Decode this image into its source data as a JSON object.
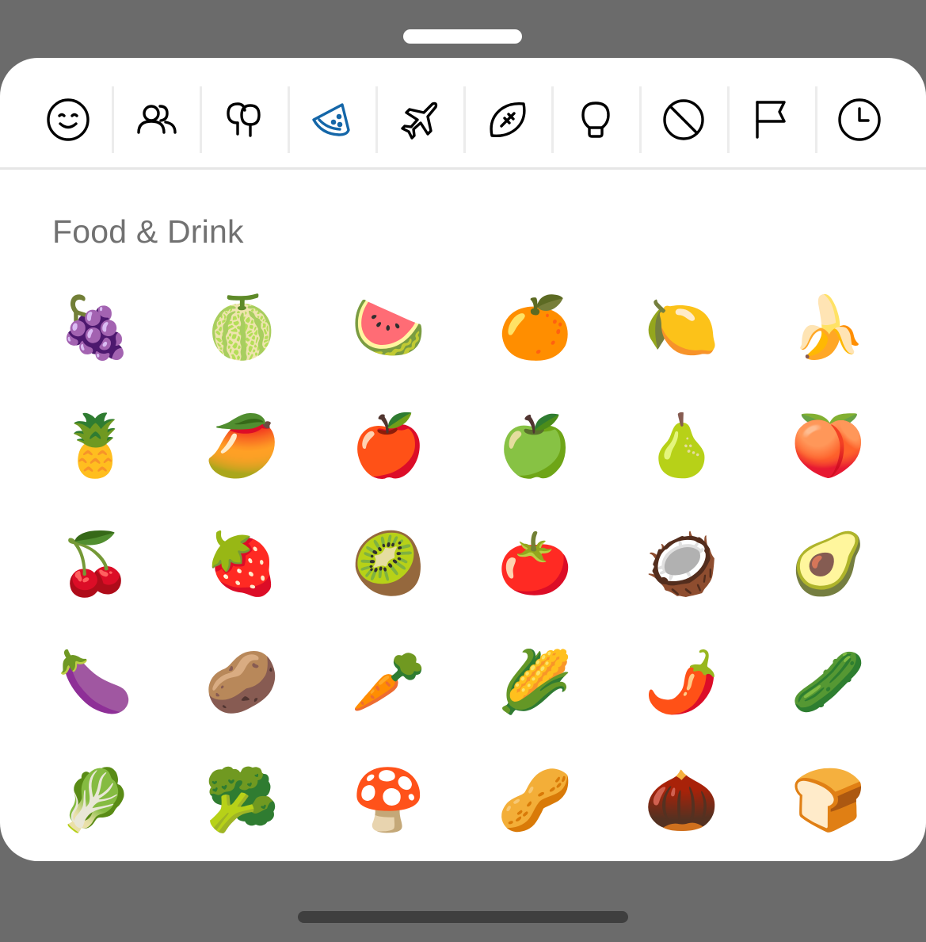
{
  "section_title": "Food & Drink",
  "accent_color": "#1466a8",
  "category_tabs": [
    {
      "icon": "smiley-face-icon",
      "active": false
    },
    {
      "icon": "people-icon",
      "active": false
    },
    {
      "icon": "trees-nature-icon",
      "active": false
    },
    {
      "icon": "watermelon-slice-food-icon",
      "active": true
    },
    {
      "icon": "airplane-travel-icon",
      "active": false
    },
    {
      "icon": "football-activity-icon",
      "active": false
    },
    {
      "icon": "lightbulb-objects-icon",
      "active": false
    },
    {
      "icon": "prohibited-symbols-icon",
      "active": false
    },
    {
      "icon": "flag-icon",
      "active": false
    },
    {
      "icon": "clock-recent-icon",
      "active": false
    }
  ],
  "emojis": [
    "🍇",
    "🍈",
    "🍉",
    "🍊",
    "🍋",
    "🍌",
    "🍍",
    "🥭",
    "🍎",
    "🍏",
    "🍐",
    "🍑",
    "🍒",
    "🍓",
    "🥝",
    "🍅",
    "🥥",
    "🥑",
    "🍆",
    "🥔",
    "🥕",
    "🌽",
    "🌶️",
    "🥒",
    "🥬",
    "🥦",
    "🍄",
    "🥜",
    "🌰",
    "🍞"
  ]
}
